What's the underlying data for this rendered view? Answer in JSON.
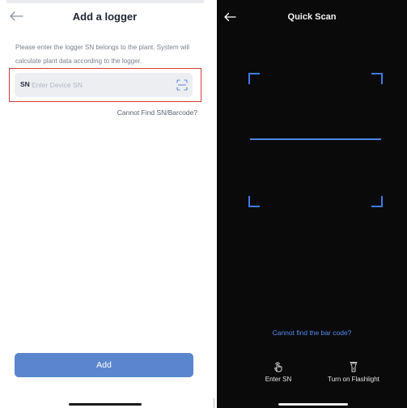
{
  "add_logger": {
    "title": "Add a logger",
    "description": "Please enter the logger SN belongs to the plant. System will calculate plant data according to the logger.",
    "sn_label": "SN",
    "sn_placeholder": "Enter Device SN",
    "sn_value": "",
    "cannot_find_link": "Cannot Find SN/Barcode?",
    "add_button": "Add",
    "highlight_color": "#d53b3b",
    "accent_color": "#5b86cf"
  },
  "quick_scan": {
    "title": "Quick Scan",
    "cannot_find_link": "Cannot find the bar code?",
    "enter_sn_label": "Enter SN",
    "flashlight_label": "Turn on Flashlight",
    "frame_color": "#3d7be0"
  },
  "icons": {
    "back": "back-arrow-icon",
    "scan": "barcode-scan-icon",
    "enter_sn": "hand-tap-icon",
    "flashlight": "flashlight-icon"
  }
}
